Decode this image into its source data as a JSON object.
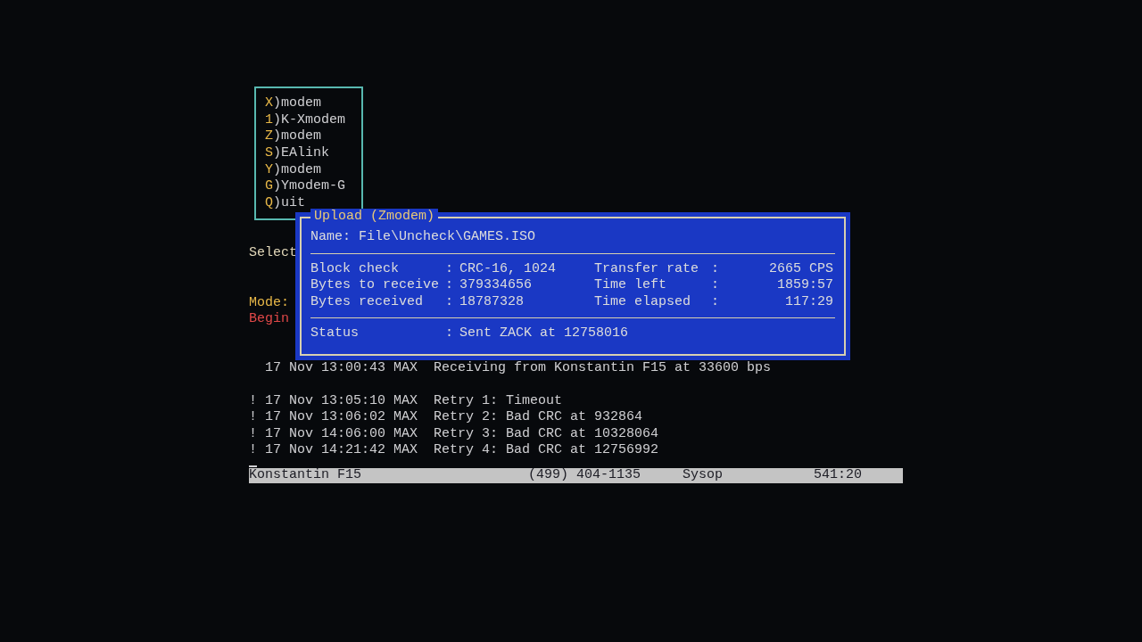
{
  "menu": {
    "items": [
      {
        "key": "X",
        "label": ")modem"
      },
      {
        "key": "1",
        "label": ")K-Xmodem"
      },
      {
        "key": "Z",
        "label": ")modem"
      },
      {
        "key": "S",
        "label": ")EAlink"
      },
      {
        "key": "Y",
        "label": ")modem"
      },
      {
        "key": "G",
        "label": ")Ymodem-G"
      },
      {
        "key": "Q",
        "label": ")uit"
      }
    ]
  },
  "prompt": "Select",
  "mode_label": "Mode:",
  "mode_value": "Begin",
  "dialog": {
    "title": "Upload (Zmodem)",
    "name_label": "Name:",
    "name_value": "File\\Uncheck\\GAMES.ISO",
    "left_fields": [
      {
        "label": "Block check",
        "value": "CRC-16, 1024"
      },
      {
        "label": "Bytes to receive",
        "value": "379334656"
      },
      {
        "label": "Bytes received",
        "value": "18787328"
      }
    ],
    "right_fields": [
      {
        "label": "Transfer rate",
        "value": "2665 CPS"
      },
      {
        "label": "Time left",
        "value": "1859:57"
      },
      {
        "label": "Time elapsed",
        "value": "117:29"
      }
    ],
    "status_label": "Status",
    "status_value": "Sent ZACK at 12758016",
    "separator": ":"
  },
  "log": [
    [
      {
        "text": "17 Nov 13:00:43 MAX  Receiving from Konstantin F15 at 33600 bps"
      }
    ],
    [
      {
        "marker": "!",
        "text": "17 Nov 13:05:10 MAX  Retry 1: Timeout"
      },
      {
        "marker": "!",
        "text": "17 Nov 13:06:02 MAX  Retry 2: Bad CRC at 932864"
      },
      {
        "marker": "!",
        "text": "17 Nov 14:06:00 MAX  Retry 3: Bad CRC at 10328064"
      },
      {
        "marker": "!",
        "text": "17 Nov 14:21:42 MAX  Retry 4: Bad CRC at 12756992"
      }
    ]
  ],
  "status_bar": {
    "user": "Konstantin F15",
    "phone": "(499) 404-1135",
    "role": "Sysop",
    "time": "541:20"
  }
}
